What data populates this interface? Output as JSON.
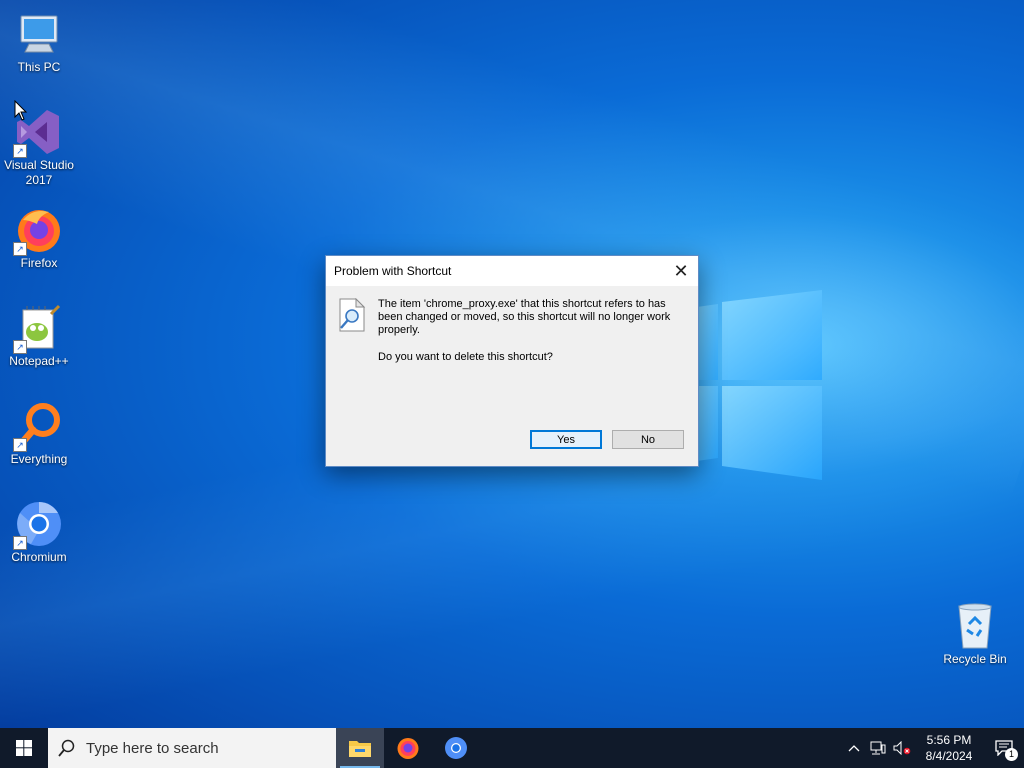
{
  "desktop": {
    "icons": [
      {
        "label": "This PC"
      },
      {
        "label": "Visual Studio 2017"
      },
      {
        "label": "Firefox"
      },
      {
        "label": "Notepad++"
      },
      {
        "label": "Everything"
      },
      {
        "label": "Chromium"
      },
      {
        "label": "Recycle Bin"
      }
    ]
  },
  "dialog": {
    "title": "Problem with Shortcut",
    "message": "The item 'chrome_proxy.exe' that this shortcut refers to has been changed or moved, so this shortcut will no longer work properly.",
    "question": "Do you want to delete this shortcut?",
    "yes_label": "Yes",
    "no_label": "No",
    "close_glyph": "✕",
    "icon": "shortcut-search-icon"
  },
  "taskbar": {
    "search_placeholder": "Type here to search",
    "pinned": [
      "file-explorer-icon",
      "firefox-icon",
      "chromium-icon"
    ],
    "time": "5:56 PM",
    "date": "8/4/2024",
    "notification_count": "1"
  },
  "colors": {
    "accent": "#0078d7",
    "taskbar_bg": "#101a2a",
    "desktop_blue": "#0a6bd6"
  }
}
